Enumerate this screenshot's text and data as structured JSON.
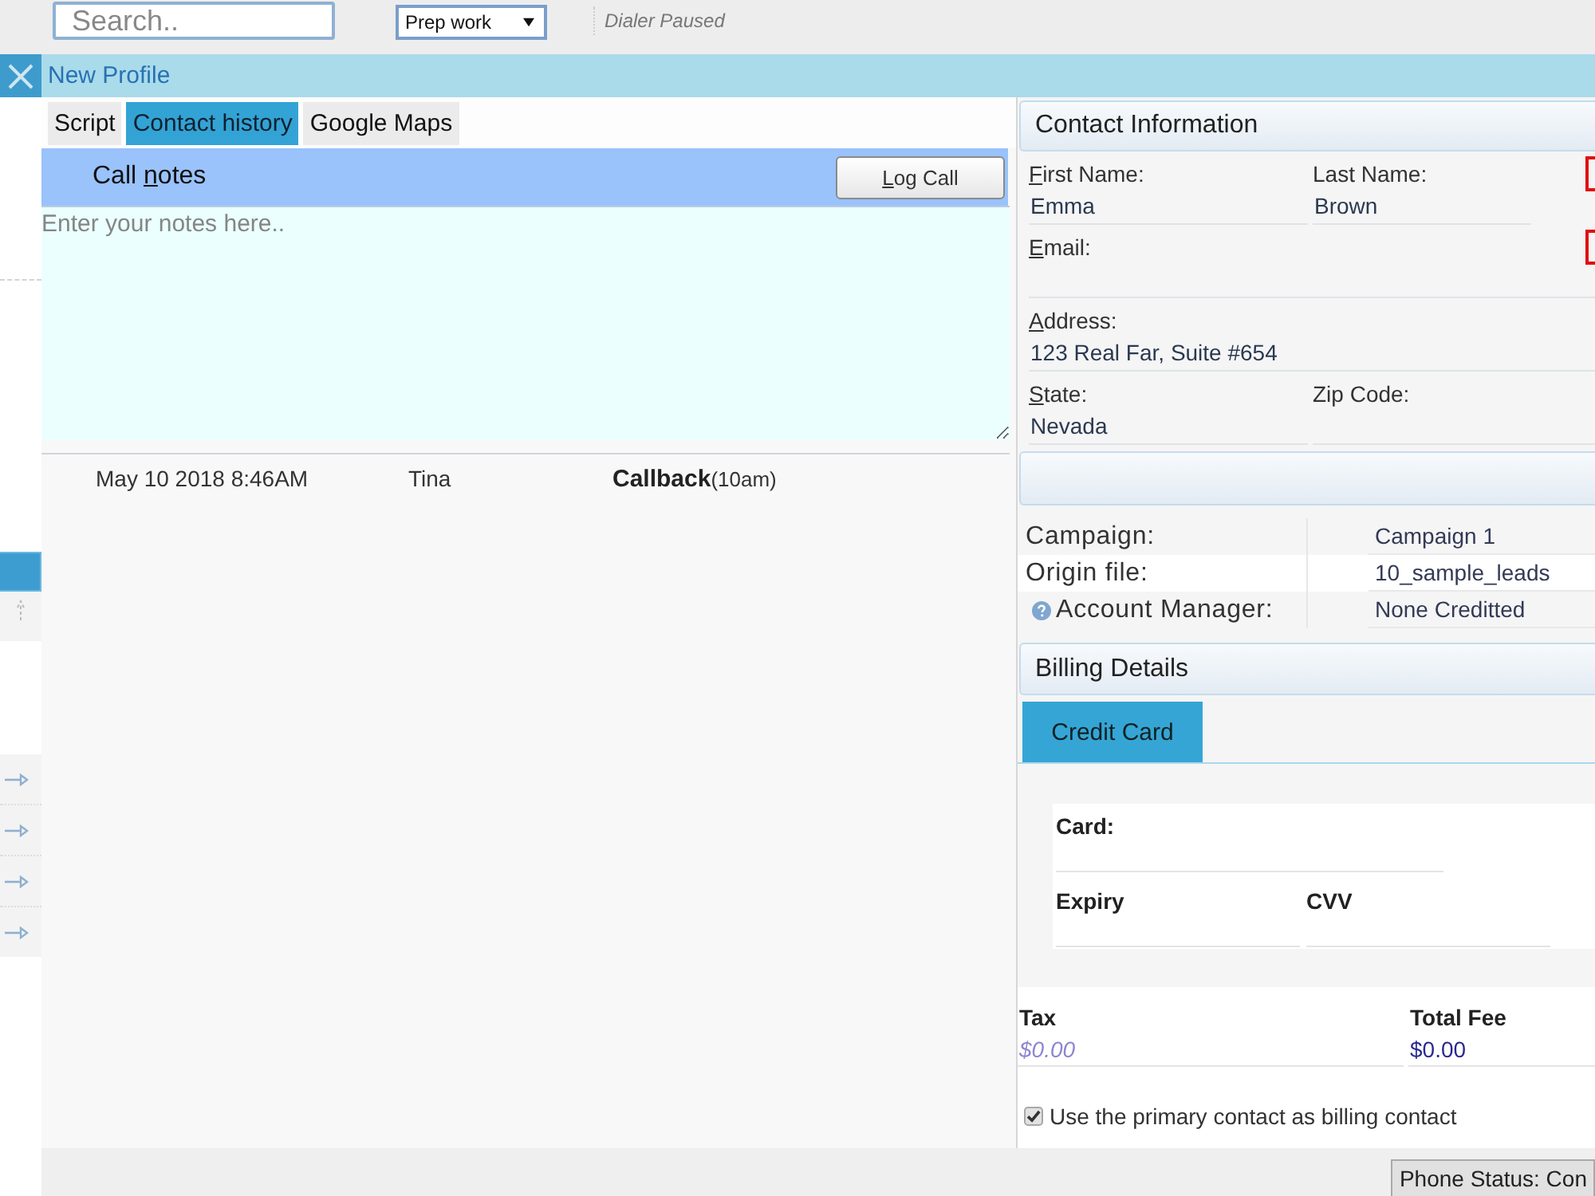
{
  "top_bar": {
    "search": {
      "placeholder": "Search.."
    },
    "mode_select": {
      "value": "Prep work"
    },
    "dialer_status": "Dialer Paused"
  },
  "profile_bar": {
    "title": "New Profile"
  },
  "tabs": [
    {
      "label": "Script",
      "selected": false
    },
    {
      "label": "Contact history",
      "selected": true
    },
    {
      "label": "Google Maps",
      "selected": false
    }
  ],
  "call_notes": {
    "title_parts": {
      "before": "Call ",
      "key": "n",
      "after": "otes"
    },
    "log_button": {
      "key": "L",
      "after": "og Call"
    },
    "placeholder": "Enter your notes here.."
  },
  "history": [
    {
      "date": "May 10 2018 8:46AM",
      "agent": "Tina",
      "outcome": "Callback",
      "detail": "(10am)"
    }
  ],
  "contact_information": {
    "title": "Contact Information",
    "rows": [
      {
        "edge_button": true,
        "fields": [
          {
            "label_parts": {
              "key": "F",
              "after": "irst Name:"
            },
            "value": "Emma"
          },
          {
            "label": "Last Name:",
            "value": "Brown"
          }
        ]
      },
      {
        "edge_button": true,
        "fields": [
          {
            "label_parts": {
              "key": "E",
              "after": "mail:"
            }
          }
        ]
      },
      {
        "edge_button": false,
        "fields": [
          {
            "label_parts": {
              "key": "A",
              "after": "ddress:"
            },
            "value": "123 Real Far, Suite #654"
          }
        ]
      },
      {
        "edge_button": false,
        "fields": [
          {
            "label_parts": {
              "key": "S",
              "after": "tate:"
            },
            "value": "Nevada"
          },
          {
            "label": "Zip Code:"
          }
        ]
      }
    ]
  },
  "lead_details": [
    {
      "label": "Campaign:",
      "value": "Campaign 1",
      "help": false
    },
    {
      "label": "Origin file:",
      "value": "10_sample_leads",
      "help": false
    },
    {
      "label": "Account Manager:",
      "value": "None Creditted",
      "help": true
    }
  ],
  "billing": {
    "title": "Billing Details",
    "tabs": [
      {
        "label": "Credit Card",
        "selected": true
      }
    ],
    "card_rows": [
      {
        "fields": [
          {
            "label": "Card:"
          }
        ]
      },
      {
        "fields": [
          {
            "label": "Expiry"
          },
          {
            "label": "CVV"
          }
        ]
      }
    ],
    "totals": [
      {
        "label": "Tax",
        "placeholder": "$0.00"
      },
      {
        "label": "Total Fee",
        "value": "$0.00"
      }
    ],
    "use_primary_contact": {
      "label": "Use the primary contact as billing contact",
      "checked": true
    }
  },
  "status_bar": {
    "phone_status": "Phone Status: Con"
  }
}
